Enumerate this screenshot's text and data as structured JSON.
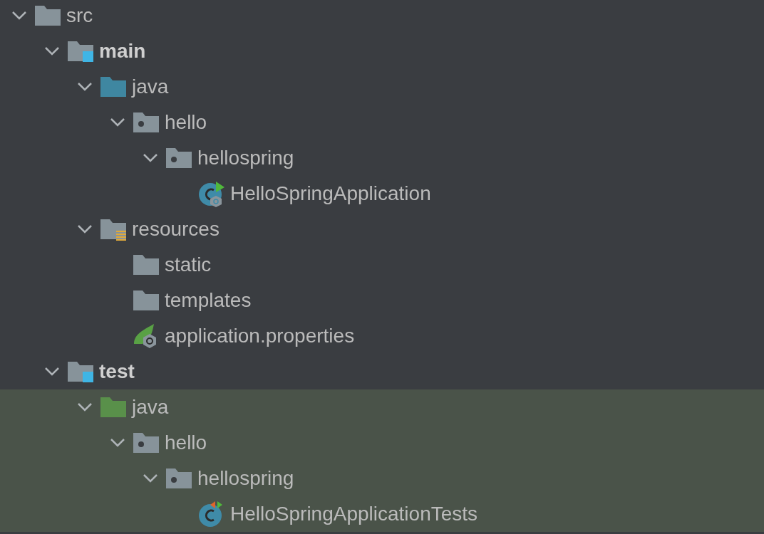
{
  "tree": [
    {
      "name": "src",
      "kind": "folder",
      "expanded": true,
      "highlighted": false,
      "children": [
        {
          "name": "main",
          "kind": "module",
          "expanded": true,
          "highlighted": false,
          "children": [
            {
              "name": "java",
              "kind": "source-root",
              "expanded": true,
              "highlighted": false,
              "children": [
                {
                  "name": "hello",
                  "kind": "package",
                  "expanded": true,
                  "highlighted": false,
                  "children": [
                    {
                      "name": "hellospring",
                      "kind": "package",
                      "expanded": true,
                      "highlighted": false,
                      "children": [
                        {
                          "name": "HelloSpringApplication",
                          "kind": "spring-class",
                          "highlighted": false
                        }
                      ]
                    }
                  ]
                }
              ]
            },
            {
              "name": "resources",
              "kind": "resources-root",
              "expanded": true,
              "highlighted": false,
              "children": [
                {
                  "name": "static",
                  "kind": "folder",
                  "highlighted": false
                },
                {
                  "name": "templates",
                  "kind": "folder",
                  "highlighted": false
                },
                {
                  "name": "application.properties",
                  "kind": "spring-properties",
                  "highlighted": false
                }
              ]
            }
          ]
        },
        {
          "name": "test",
          "kind": "module",
          "expanded": true,
          "highlighted": false,
          "children": [
            {
              "name": "java",
              "kind": "test-root",
              "expanded": true,
              "highlighted": true,
              "children": [
                {
                  "name": "hello",
                  "kind": "package",
                  "expanded": true,
                  "highlighted": true,
                  "children": [
                    {
                      "name": "hellospring",
                      "kind": "package",
                      "expanded": true,
                      "highlighted": true,
                      "children": [
                        {
                          "name": "HelloSpringApplicationTests",
                          "kind": "test-class",
                          "highlighted": true
                        }
                      ]
                    }
                  ]
                }
              ]
            }
          ]
        }
      ]
    }
  ]
}
